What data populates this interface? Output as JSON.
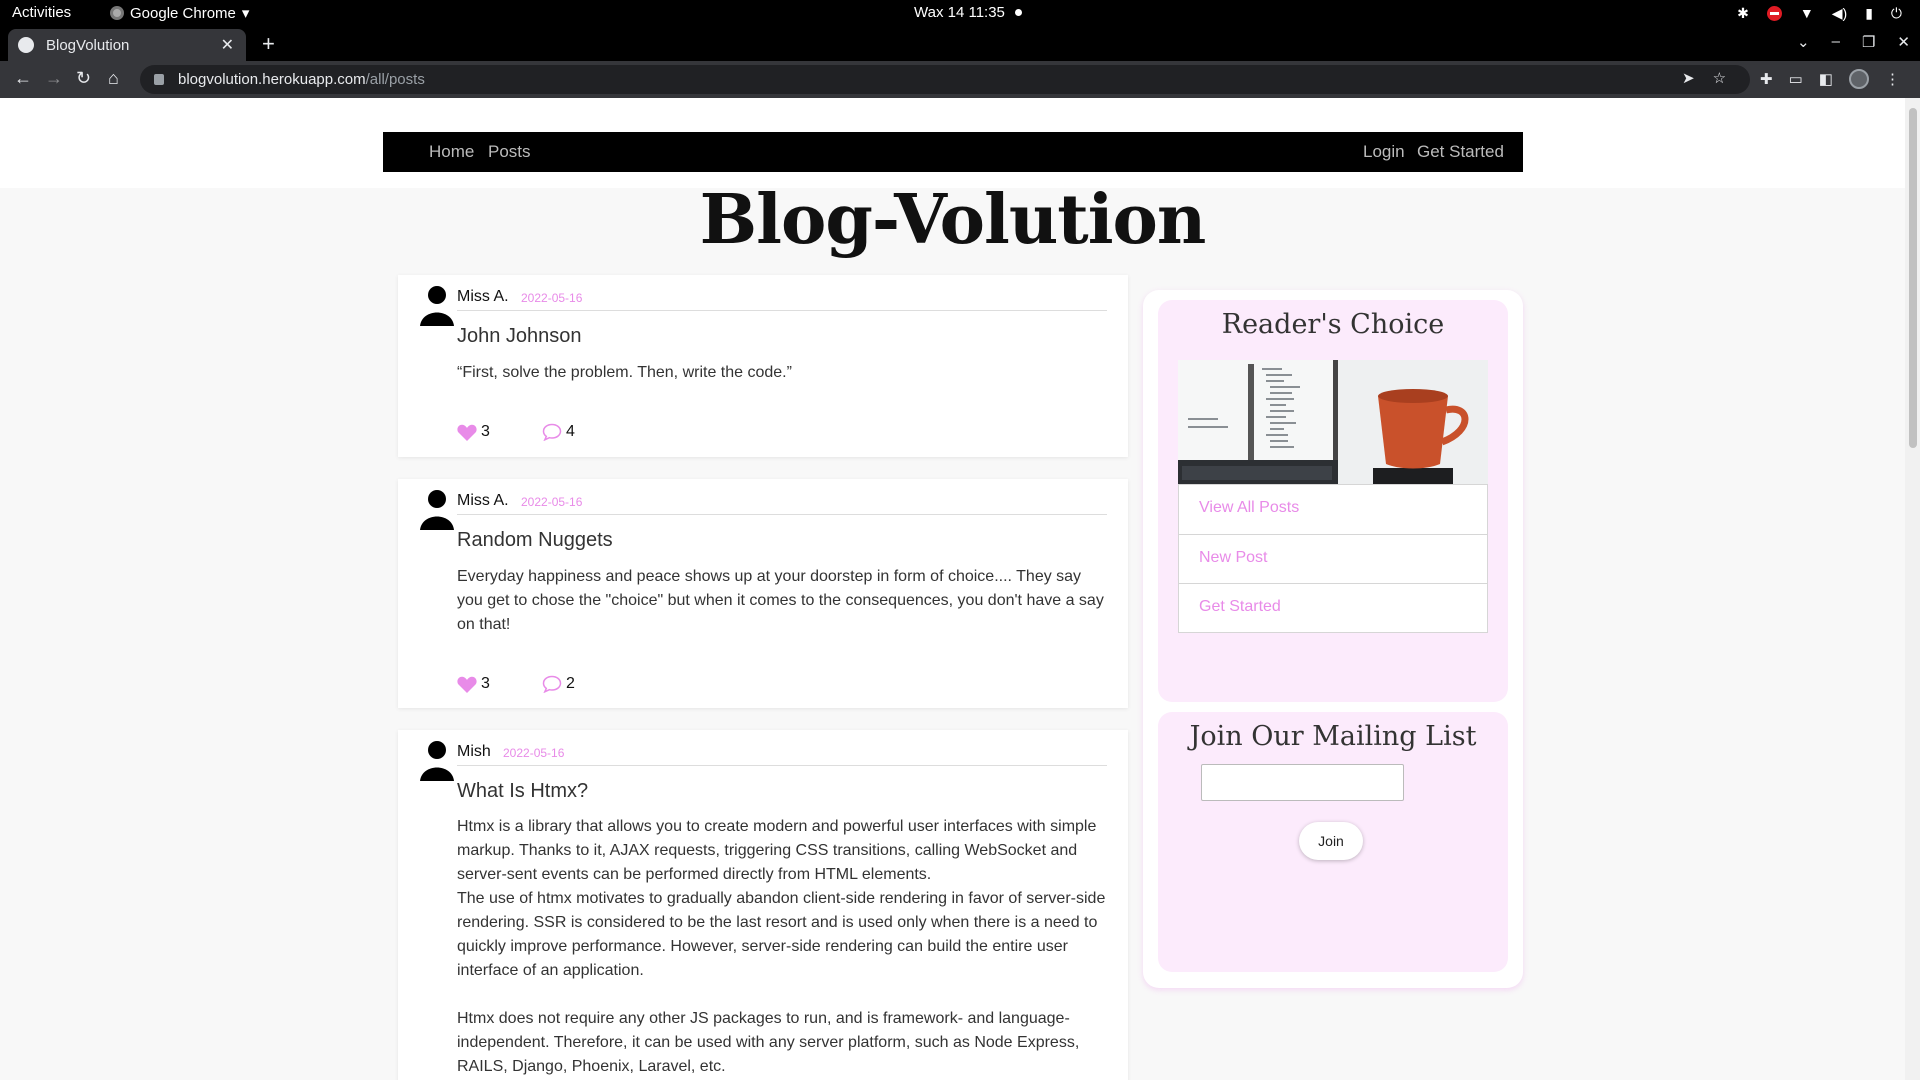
{
  "os_bar": {
    "activities": "Activities",
    "app_name": "Google Chrome",
    "clock": "Wax 14  11:35"
  },
  "browser": {
    "tab_title": "BlogVolution",
    "url_host": "blogvolution.herokuapp.com",
    "url_path": "/all/posts"
  },
  "nav": {
    "home": "Home",
    "posts": "Posts",
    "login": "Login",
    "get_started": "Get Started"
  },
  "site_title": "Blog-Volution",
  "posts": [
    {
      "author": "Miss A.",
      "date": "2022-05-16",
      "title": "John Johnson",
      "body": "“First, solve the problem. Then, write the code.”",
      "likes": "3",
      "comments": "4"
    },
    {
      "author": "Miss A.",
      "date": "2022-05-16",
      "title": "Random Nuggets",
      "body": "Everyday happiness and peace shows up at your doorstep in form of choice.... They say you get to chose the \"choice\" but when it comes to the consequences, you don't have a say on that!",
      "likes": "3",
      "comments": "2"
    },
    {
      "author": "Mish",
      "date": "2022-05-16",
      "title": "What Is Htmx?",
      "body_p1": "Htmx is a library that allows you to create modern and powerful user interfaces with simple markup. Thanks to it, AJAX requests, triggering CSS transitions, calling WebSocket and server-sent events can be performed directly from HTML elements.",
      "body_p2": "The use of htmx motivates to gradually abandon client-side rendering in favor of server-side rendering. SSR is considered to be the last resort and is used only when there is a need to quickly improve performance. However, server-side rendering can build the entire user interface of an application.",
      "body_p3": "Htmx does not require any other JS packages to run, and is framework- and language-independent. Therefore, it can be used with any server platform, such as Node Express, RAILS, Django, Phoenix, Laravel, etc."
    }
  ],
  "sidebar": {
    "readers_choice": {
      "heading": "Reader's Choice",
      "links": [
        "View All Posts",
        "New Post",
        "Get Started"
      ]
    },
    "mailing": {
      "heading": "Join Our Mailing List",
      "input_value": "",
      "button": "Join"
    }
  },
  "colors": {
    "accent": "#e88be8",
    "card_bg": "#fcebfc",
    "nav_bg": "#000000"
  }
}
